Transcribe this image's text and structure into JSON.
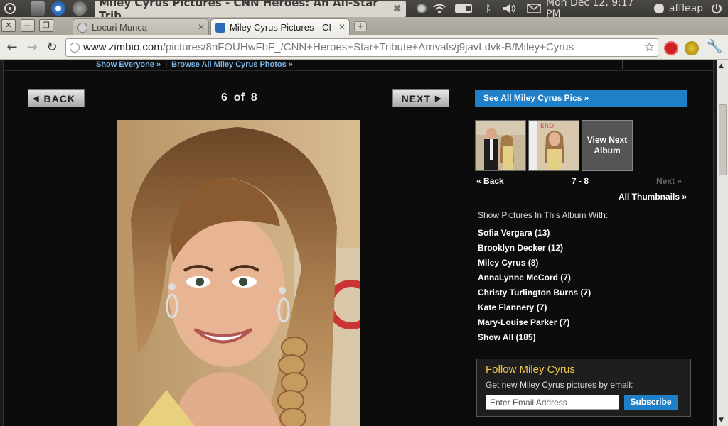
{
  "panel": {
    "window_title": "Miley Cyrus Pictures - CNN Heroes: An All-Star Trib...",
    "datetime": "Mon Dec 12,  9:17 PM",
    "user": "affleap"
  },
  "tabs": [
    {
      "label": "Locuri Munca"
    },
    {
      "label": "Miley Cyrus Pictures - CI"
    }
  ],
  "toolbar": {
    "url_host": "www.zimbio.com",
    "url_path": "/pictures/8nFOUHwFbF_/CNN+Heroes+Star+Tribute+Arrivals/j9javLdvk-B/Miley+Cyrus"
  },
  "subnav": {
    "show_everyone": "Show Everyone »",
    "browse_all": "Browse All Miley Cyrus Photos »"
  },
  "pager": {
    "back_label": "BACK",
    "next_label": "NEXT",
    "current": "6",
    "of_word": "of",
    "total": "8"
  },
  "sidebar": {
    "see_all": "See All Miley Cyrus Pics »",
    "view_next_album": "View Next Album",
    "back": "Back",
    "range": "7 - 8",
    "next": "Next »",
    "all_thumbnails": "All Thumbnails »",
    "show_with_heading": "Show Pictures In This Album With:",
    "people": [
      "Sofia Vergara (13)",
      "Brooklyn Decker (12)",
      "Miley Cyrus (8)",
      "AnnaLynne McCord (7)",
      "Christy Turlington Burns (7)",
      "Kate Flannery (7)",
      "Mary-Louise Parker (7)",
      "Show All (185)"
    ]
  },
  "follow": {
    "title": "Follow Miley Cyrus",
    "desc": "Get new Miley Cyrus pictures by email:",
    "email_placeholder": "Enter Email Address",
    "subscribe": "Subscribe"
  },
  "colors": {
    "accent_blue": "#1f7fc7",
    "follow_title": "#f0c84a",
    "link_blue": "#7fb6e8"
  }
}
